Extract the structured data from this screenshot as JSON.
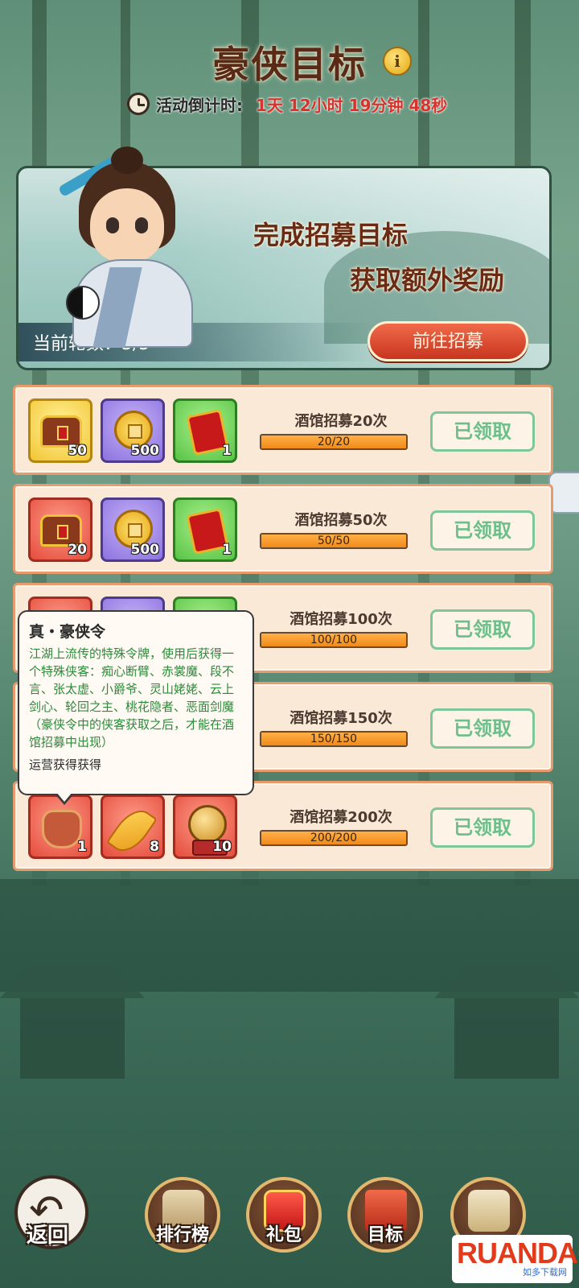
{
  "header": {
    "title": "豪侠目标",
    "info_icon": "i",
    "countdown_label": "活动倒计时:",
    "countdown_value": "1天  12小时  19分钟  48秒"
  },
  "banner": {
    "line1": "完成招募目标",
    "line2": "获取额外奖励",
    "round_label": "当前轮数：",
    "round_value": "5/5",
    "go_button": "前往招募"
  },
  "tasks": [
    {
      "title": "酒馆招募20次",
      "progress": "20/20",
      "progress_fraction": 1.0,
      "button": "已领取",
      "rewards": [
        {
          "icon": "chest-icon",
          "count": "50",
          "rarity": "gold"
        },
        {
          "icon": "coin-icon",
          "count": "500",
          "rarity": "purple"
        },
        {
          "icon": "token-icon",
          "count": "1",
          "rarity": "green"
        }
      ]
    },
    {
      "title": "酒馆招募50次",
      "progress": "50/50",
      "progress_fraction": 1.0,
      "button": "已领取",
      "rewards": [
        {
          "icon": "chest-icon",
          "count": "20",
          "rarity": "red"
        },
        {
          "icon": "coin-icon",
          "count": "500",
          "rarity": "purple"
        },
        {
          "icon": "token-icon",
          "count": "1",
          "rarity": "green"
        }
      ]
    },
    {
      "title": "酒馆招募100次",
      "progress": "100/100",
      "progress_fraction": 1.0,
      "button": "已领取"
    },
    {
      "title": "酒馆招募150次",
      "progress": "150/150",
      "progress_fraction": 1.0,
      "button": "已领取"
    },
    {
      "title": "酒馆招募200次",
      "progress": "200/200",
      "progress_fraction": 1.0,
      "button": "已领取",
      "rewards": [
        {
          "icon": "plaque-icon",
          "count": "1",
          "rarity": "red"
        },
        {
          "icon": "leaf-icon",
          "count": "8",
          "rarity": "red"
        },
        {
          "icon": "orb-icon",
          "count": "10",
          "rarity": "red"
        }
      ]
    }
  ],
  "tooltip": {
    "title": "真・豪侠令",
    "description": "江湖上流传的特殊令牌，使用后获得一个特殊侠客：痴心断臂、赤裳魔、段不言、张太虚、小爵爷、灵山姥姥、云上剑心、轮回之主、桃花隐者、恶面剑魔（豪侠令中的侠客获取之后，才能在酒馆招募中出现）",
    "source": "运营获得获得"
  },
  "bottom_nav": {
    "back": "返回",
    "ranking": "排行榜",
    "gift": "礼包",
    "goal": "目标"
  },
  "watermark": {
    "main": "RUANDAO",
    "sub": "如多下载网"
  }
}
